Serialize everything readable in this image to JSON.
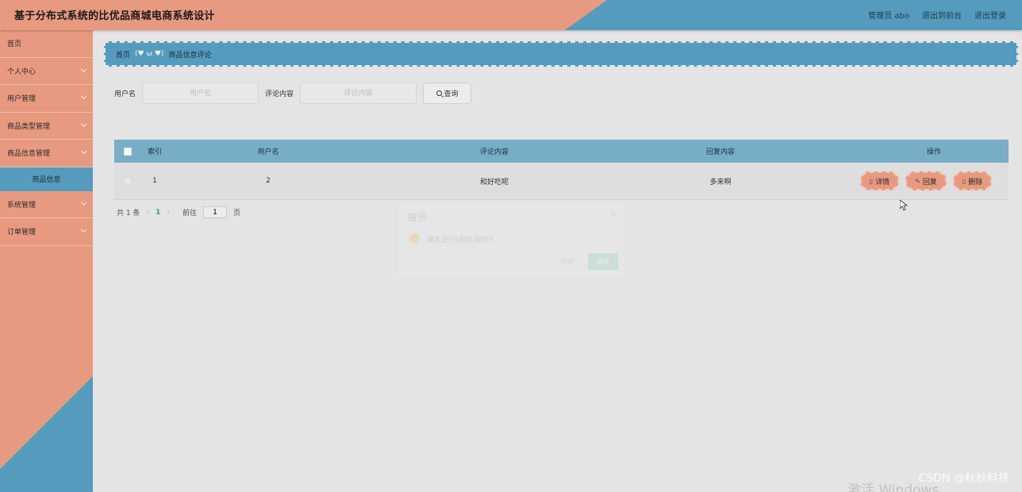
{
  "app": {
    "title": "基于分布式系统的比优品商城电商系统设计"
  },
  "header": {
    "admin_label": "管理员 abo",
    "back_to_front": "退出到前台",
    "logout": "退出登录"
  },
  "sidebar": {
    "items": [
      {
        "label": "首页",
        "has_chevron": false
      },
      {
        "label": "个人中心",
        "has_chevron": true
      },
      {
        "label": "用户管理",
        "has_chevron": true
      },
      {
        "label": "商品类型管理",
        "has_chevron": true
      },
      {
        "label": "商品信息管理",
        "has_chevron": true
      },
      {
        "label": "系统管理",
        "has_chevron": true
      },
      {
        "label": "订单管理",
        "has_chevron": true
      }
    ],
    "active_sub": "商品信息"
  },
  "breadcrumb": {
    "home": "首页",
    "separator": "(♥ ω ♥)",
    "current": "商品信息评论"
  },
  "search": {
    "username_label": "用户名",
    "username_placeholder": "用户名",
    "comment_label": "评论内容",
    "comment_placeholder": "评论内容",
    "query_button": "查询"
  },
  "table": {
    "headers": {
      "index": "索引",
      "username": "用户名",
      "comment": "评论内容",
      "reply": "回复内容",
      "ops": "操作"
    },
    "rows": [
      {
        "index": "1",
        "username": "2",
        "comment": "和好吃呢",
        "reply": "多来啊"
      }
    ],
    "op_labels": {
      "detail": "详情",
      "reply": "回复",
      "delete": "删除"
    }
  },
  "pagination": {
    "total": "共 1 条",
    "current_page": "1",
    "goto_prefix": "前往",
    "goto_value": "1",
    "goto_suffix": "页"
  },
  "dialog": {
    "title": "提示",
    "message": "确定进行[删除]操作?",
    "cancel": "取消",
    "confirm": "确定"
  },
  "watermarks": {
    "csdn": "CSDN @秋秋科技",
    "windows": "激活 Windows"
  },
  "colors": {
    "salmon": "#e89a80",
    "blue": "#549bbd",
    "table_header": "#78adc6",
    "background": "#e4e4e4"
  }
}
